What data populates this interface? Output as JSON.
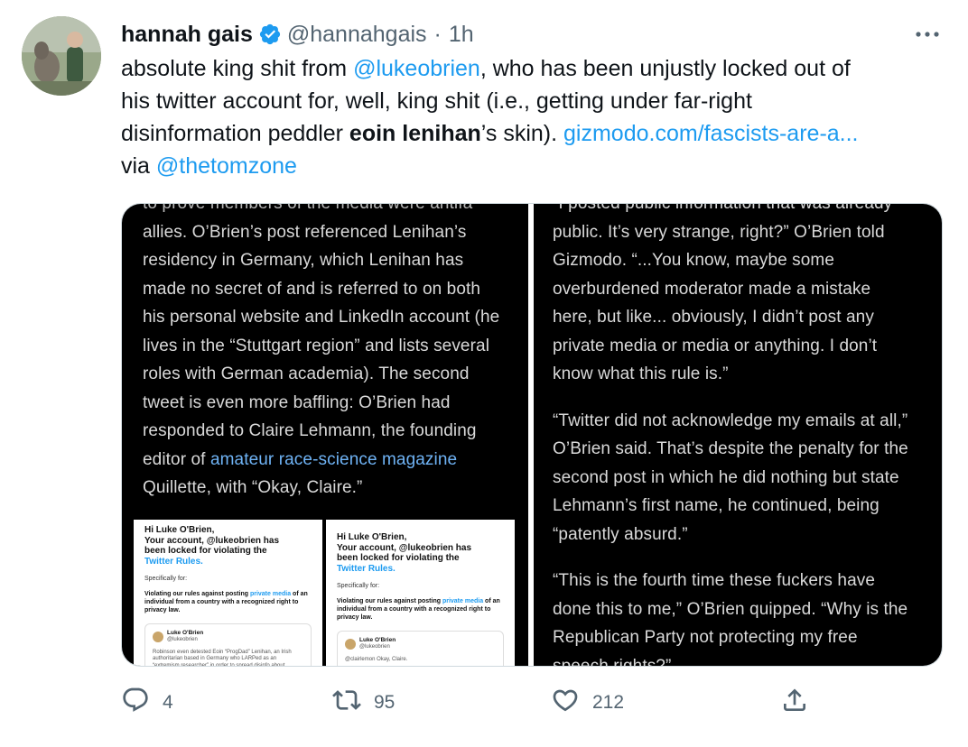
{
  "tweet": {
    "display_name": "hannah gais",
    "handle": "@hannahgais",
    "separator": "·",
    "time": "1h",
    "text_lines": [
      [
        {
          "t": "absolute king shit from ",
          "k": "plain"
        },
        {
          "t": "@lukeobrien",
          "k": "mention"
        },
        {
          "t": ", who has been unjustly locked out of",
          "k": "plain"
        }
      ],
      [
        {
          "t": "his twitter account for, well, king shit (i.e., getting under far-right",
          "k": "plain"
        }
      ],
      [
        {
          "t": "disinformation peddler ",
          "k": "plain"
        },
        {
          "t": "eoin lenihan",
          "k": "bold"
        },
        {
          "t": "’s skin). ",
          "k": "plain"
        },
        {
          "t": "gizmodo.com/fascists-are-a...",
          "k": "link"
        }
      ],
      [
        {
          "t": "via ",
          "k": "plain"
        },
        {
          "t": "@thetomzone",
          "k": "mention"
        }
      ]
    ]
  },
  "media": {
    "left_article": [
      "to prove members of the media were antifa",
      "allies. O’Brien’s post referenced Lenihan’s",
      "residency in Germany, which Lenihan has",
      "made no secret of and is referred to on both",
      "his personal website and LinkedIn account (he",
      "lives in the “Stuttgart region” and lists several",
      "roles with German academia). The second",
      "tweet is even more baffling: O’Brien had",
      "responded to Claire Lehmann, the founding"
    ],
    "left_link_prefix": "editor of ",
    "left_link_text": "amateur race-science magazine",
    "left_last_line": "Quillette, with “Okay, Claire.”",
    "notice_1": {
      "greeting": "Hi Luke O'Brien,",
      "line2": "Your account, @lukeobrien has",
      "line3": "been locked for violating the",
      "rules": "Twitter Rules.",
      "specifically": "Specifically for:",
      "body_pre": "Violating our rules against posting ",
      "body_link": "private media",
      "body_post": " of an individual from a country with a recognized right to privacy law.",
      "card_name": "Luke O'Brien",
      "card_handle": "@lukeobrien",
      "card_text": "Robinson even detested Eoin “ProgDad” Lenihan, an Irish authoritarian based in Germany who LARPed as an “extremism researcher” in order to spread disinfo about American journalists that led to death threats. Lenihan was also tight with Stewart, The Shed and white"
    },
    "notice_2": {
      "greeting": "Hi Luke O'Brien,",
      "line2": "Your account, @lukeobrien has",
      "line3": "been locked for violating the",
      "rules": "Twitter Rules.",
      "specifically": "Specifically for:",
      "body_pre": "Violating our rules against posting ",
      "body_link": "private media",
      "body_post": " of an individual from a country with a recognized right to privacy law.",
      "card_name": "Luke O'Brien",
      "card_handle": "@lukeobrien",
      "card_text": "@clairlemon Okay, Claire."
    },
    "right_paragraphs": [
      [
        "“I posted public information that was already",
        "public. It’s very strange, right?” O’Brien told",
        "Gizmodo. “...You know, maybe some",
        "overburdened moderator made a mistake",
        "here, but like... obviously, I didn’t post any",
        "private media or media or anything. I don’t",
        "know what this rule is.”"
      ],
      [
        "“Twitter did not acknowledge my emails at all,”",
        "O’Brien said. That’s despite the penalty for the",
        "second post in which he did nothing but state",
        "Lehmann’s first name, he continued, being",
        "“patently absurd.”"
      ],
      [
        "“This is the fourth time these fuckers have",
        "done this to me,” O’Brien quipped. “Why is the",
        "Republican Party not protecting my free",
        "speech rights?”"
      ]
    ]
  },
  "actions": {
    "reply_count": "4",
    "retweet_count": "95",
    "like_count": "212"
  },
  "colors": {
    "accent": "#1d9bf0",
    "secondary_text": "#536471",
    "icon": "#536471"
  },
  "icons": [
    "verified-badge-icon",
    "more-icon",
    "reply-icon",
    "retweet-icon",
    "like-icon",
    "share-icon"
  ]
}
